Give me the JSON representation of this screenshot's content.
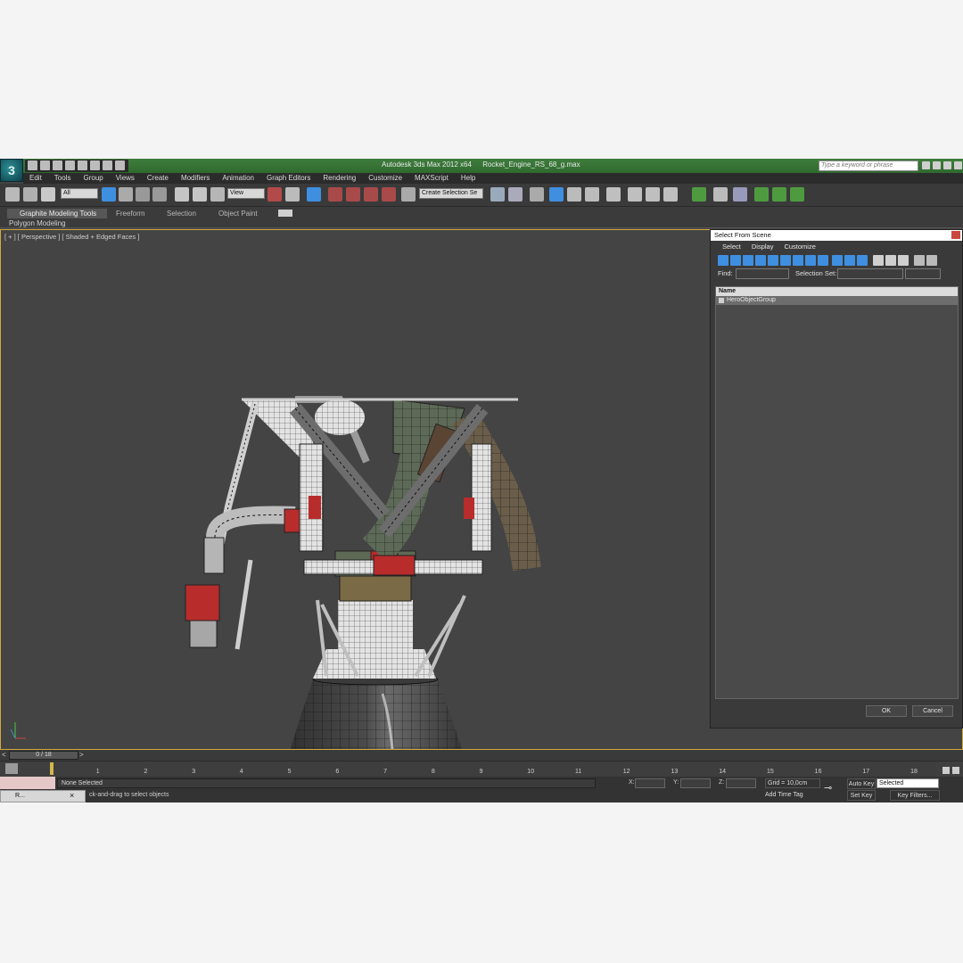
{
  "app": {
    "title": "Autodesk 3ds Max  2012 x64",
    "file": "Rocket_Engine_RS_68_g.max",
    "search_placeholder": "Type a keyword or phrase"
  },
  "menu": [
    "Edit",
    "Tools",
    "Group",
    "Views",
    "Create",
    "Modifiers",
    "Animation",
    "Graph Editors",
    "Rendering",
    "Customize",
    "MAXScript",
    "Help"
  ],
  "toolbar": {
    "selection_filter": "All",
    "reference_coord": "View",
    "named_selection": "Create Selection Se"
  },
  "ribbon": {
    "tabs": [
      "Graphite Modeling Tools",
      "Freeform",
      "Selection",
      "Object Paint"
    ],
    "sub_label": "Polygon Modeling"
  },
  "viewport": {
    "label": "[ + ] [ Perspective ] [ Shaded + Edged Faces ]"
  },
  "dialog": {
    "title": "Select From Scene",
    "menu": [
      "Select",
      "Display",
      "Customize"
    ],
    "find_label": "Find:",
    "selection_set_label": "Selection Set:",
    "column_name": "Name",
    "rows": [
      "HeroObjectGroup"
    ],
    "ok": "OK",
    "cancel": "Cancel"
  },
  "timeline": {
    "frame_counter": "0 / 18",
    "ticks": [
      "1",
      "2",
      "3",
      "4",
      "5",
      "6",
      "7",
      "8",
      "9",
      "10",
      "11",
      "12",
      "13",
      "14",
      "15",
      "16",
      "17",
      "18"
    ]
  },
  "status": {
    "selection": "None Selected",
    "prompt": "ck-and-drag to select objects",
    "x_label": "X:",
    "y_label": "Y:",
    "z_label": "Z:",
    "grid": "Grid = 10,0cm",
    "add_time_tag": "Add Time Tag",
    "auto_key": "Auto Key",
    "set_key": "Set Key",
    "key_mode": "Selected",
    "key_filters": "Key Filters...",
    "taskbar_label": "R..."
  }
}
